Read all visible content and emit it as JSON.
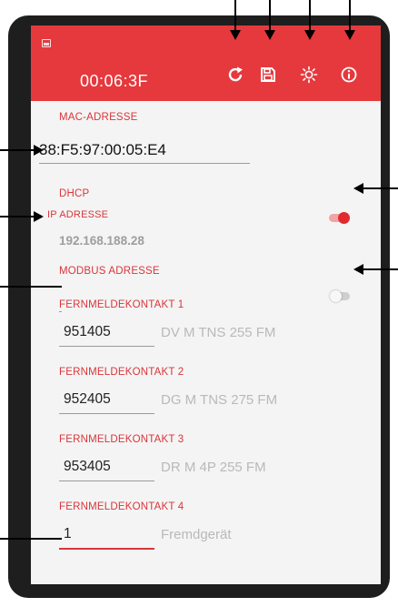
{
  "app": {
    "timer": "00:06:3F",
    "accent_color": "#e5393d"
  },
  "toolbar": {
    "buttons": [
      {
        "name": "refresh",
        "icon": "refresh-icon"
      },
      {
        "name": "save",
        "icon": "save-icon"
      },
      {
        "name": "brightness",
        "icon": "brightness-icon"
      },
      {
        "name": "info",
        "icon": "info-icon"
      }
    ]
  },
  "mac": {
    "label": "MAC-ADRESSE",
    "value": "38:F5:97:00:05:E4"
  },
  "dhcp": {
    "label": "DHCP",
    "enabled": true
  },
  "ip": {
    "label": "IP ADRESSE",
    "value": "192.168.188.28"
  },
  "modbus": {
    "label": "MODBUS ADRESSE",
    "enabled": false
  },
  "contacts": [
    {
      "label": "FERNMELDEKONTAKT 1",
      "value": "951405",
      "hint": "DV M TNS 255 FM"
    },
    {
      "label": "FERNMELDEKONTAKT 2",
      "value": "952405",
      "hint": "DG M TNS 275 FM"
    },
    {
      "label": "FERNMELDEKONTAKT 3",
      "value": "953405",
      "hint": "DR M 4P 255 FM"
    },
    {
      "label": "FERNMELDEKONTAKT 4",
      "value": "1",
      "hint": "Fremdgerät"
    }
  ]
}
